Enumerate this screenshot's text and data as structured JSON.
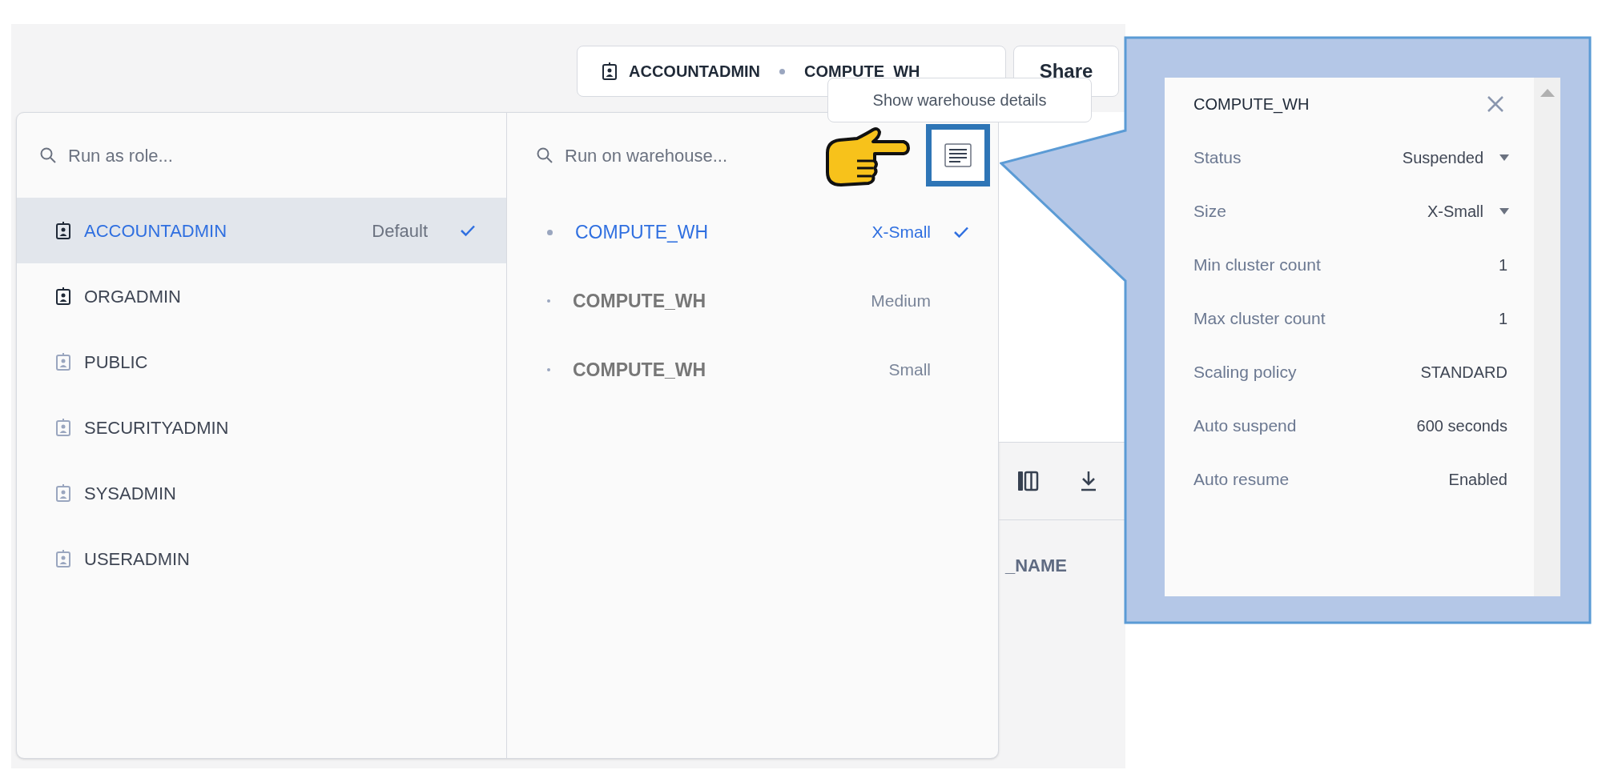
{
  "header": {
    "role": "ACCOUNTADMIN",
    "warehouse": "COMPUTE_WH",
    "share_button": "Share"
  },
  "tooltip": "Show warehouse details",
  "roles": {
    "placeholder": "Run as role...",
    "items": [
      {
        "name": "ACCOUNTADMIN",
        "note": "Default",
        "selected": true,
        "kind": "owned"
      },
      {
        "name": "ORGADMIN",
        "selected": false,
        "kind": "owned"
      },
      {
        "name": "PUBLIC",
        "selected": false,
        "kind": "inherited"
      },
      {
        "name": "SECURITYADMIN",
        "selected": false,
        "kind": "inherited"
      },
      {
        "name": "SYSADMIN",
        "selected": false,
        "kind": "inherited"
      },
      {
        "name": "USERADMIN",
        "selected": false,
        "kind": "inherited"
      }
    ]
  },
  "warehouses": {
    "placeholder": "Run on warehouse...",
    "items": [
      {
        "name": "COMPUTE_WH",
        "size": "X-Small",
        "selected": true
      },
      {
        "name": "COMPUTE_WH",
        "size": "Medium",
        "selected": false
      },
      {
        "name": "COMPUTE_WH",
        "size": "Small",
        "selected": false
      }
    ]
  },
  "background": {
    "column_header": "_NAME"
  },
  "details": {
    "title": "COMPUTE_WH",
    "rows": [
      {
        "label": "Status",
        "value": "Suspended",
        "kind": "dropdown"
      },
      {
        "label": "Size",
        "value": "X-Small",
        "kind": "dropdown"
      },
      {
        "label": "Min cluster count",
        "value": "1",
        "kind": "text"
      },
      {
        "label": "Max cluster count",
        "value": "1",
        "kind": "text"
      },
      {
        "label": "Scaling policy",
        "value": "STANDARD",
        "kind": "text"
      },
      {
        "label": "Auto suspend",
        "value": "600 seconds",
        "kind": "text"
      },
      {
        "label": "Auto resume",
        "value": "Enabled",
        "kind": "text"
      }
    ]
  }
}
